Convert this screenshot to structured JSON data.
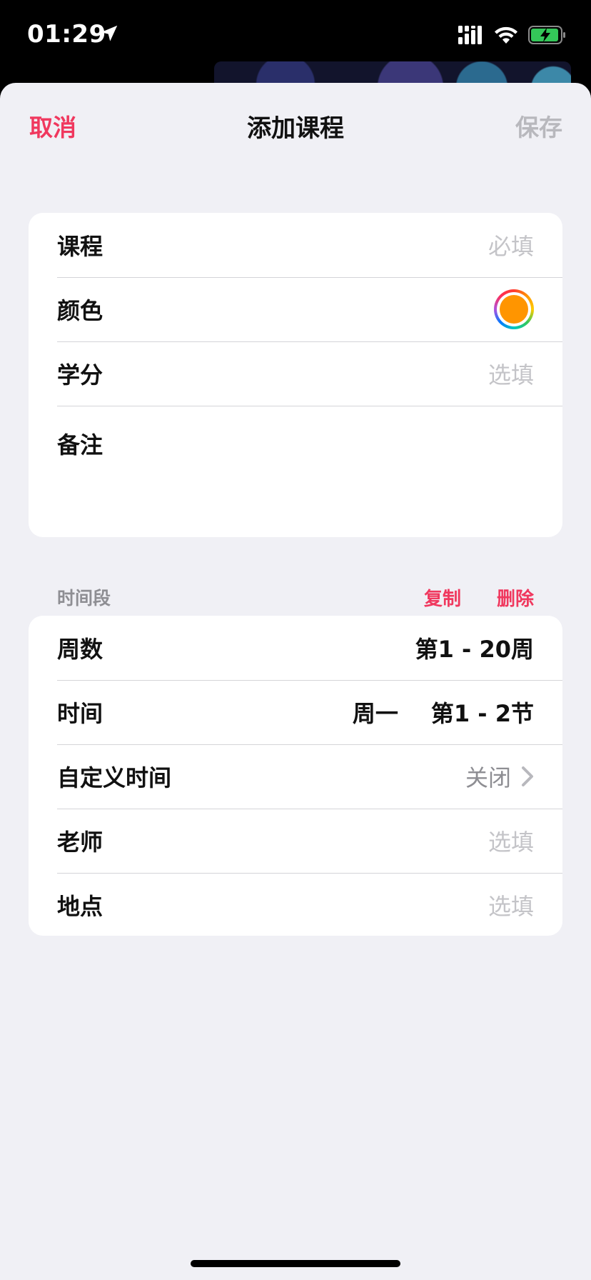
{
  "status_bar": {
    "time": "01:29",
    "icons": [
      "location-arrow-icon",
      "cellular-signal-icon",
      "wifi-icon",
      "battery-charging-icon"
    ]
  },
  "nav": {
    "cancel_label": "取消",
    "title": "添加课程",
    "save_label": "保存"
  },
  "course_card": {
    "course": {
      "label": "课程",
      "placeholder": "必填"
    },
    "color": {
      "label": "颜色",
      "value": "#ff9500"
    },
    "credits": {
      "label": "学分",
      "placeholder": "选填"
    },
    "notes": {
      "label": "备注"
    }
  },
  "time_section": {
    "header": "时间段",
    "copy_label": "复制",
    "delete_label": "删除",
    "weeks": {
      "label": "周数",
      "value": "第1 - 20周"
    },
    "time": {
      "label": "时间",
      "day": "周一",
      "period": "第1 - 2节"
    },
    "custom_time": {
      "label": "自定义时间",
      "value": "关闭"
    },
    "teacher": {
      "label": "老师",
      "placeholder": "选填"
    },
    "location": {
      "label": "地点",
      "placeholder": "选填"
    }
  },
  "colors": {
    "accent": "#f0385e",
    "placeholder": "#c4c4c8",
    "background": "#f0f0f5"
  }
}
